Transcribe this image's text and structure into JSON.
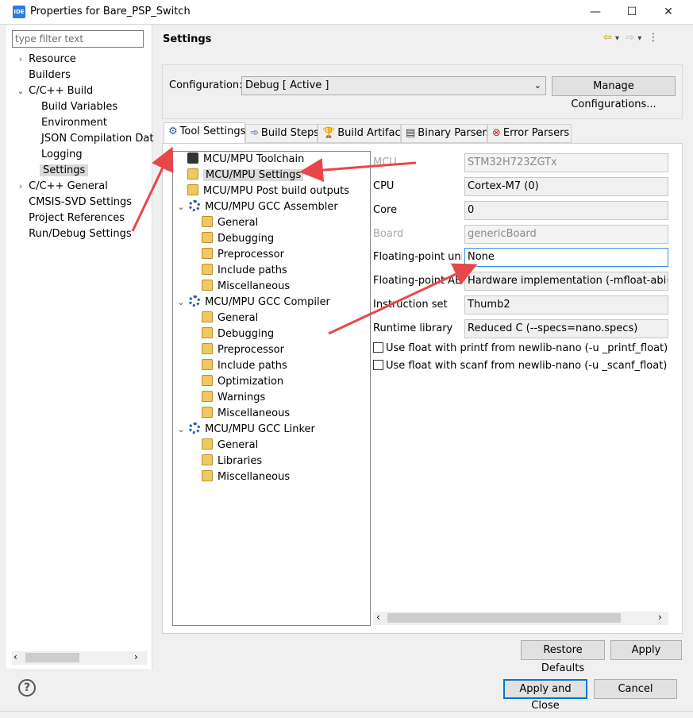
{
  "window": {
    "app_icon_text": "IDE",
    "title": "Properties for Bare_PSP_Switch",
    "minimize_glyph": "—",
    "maximize_glyph": "☐",
    "close_glyph": "✕"
  },
  "left": {
    "filter_placeholder": "type filter text",
    "tree": [
      {
        "label": "Resource",
        "chevron": "›"
      },
      {
        "label": "Builders",
        "chevron": ""
      },
      {
        "label": "C/C++ Build",
        "chevron": "⌄"
      },
      {
        "label": "Build Variables",
        "chevron": ""
      },
      {
        "label": "Environment",
        "chevron": ""
      },
      {
        "label": "JSON Compilation Dat",
        "chevron": ""
      },
      {
        "label": "Logging",
        "chevron": ""
      },
      {
        "label": "Settings",
        "chevron": "",
        "selected": true
      },
      {
        "label": "C/C++ General",
        "chevron": "›"
      },
      {
        "label": "CMSIS-SVD Settings",
        "chevron": ""
      },
      {
        "label": "Project References",
        "chevron": ""
      },
      {
        "label": "Run/Debug Settings",
        "chevron": ""
      }
    ],
    "scroll_left": "‹",
    "scroll_right": "›"
  },
  "header": {
    "title": "Settings",
    "back_icon": "⇦",
    "forward_icon": "⇨",
    "dropdown_icon": "▾",
    "menu_icon": "⋮"
  },
  "config": {
    "label": "Configuration:",
    "value": "Debug  [ Active ]",
    "manage_label": "Manage Configurations..."
  },
  "tabs": [
    {
      "label": "Tool Settings",
      "active": true
    },
    {
      "label": "Build Steps"
    },
    {
      "label": "Build Artifact"
    },
    {
      "label": "Binary Parsers"
    },
    {
      "label": "Error Parsers"
    }
  ],
  "tool_tree": [
    {
      "label": "MCU/MPU Toolchain"
    },
    {
      "label": "MCU/MPU Settings"
    },
    {
      "label": "MCU/MPU Post build outputs"
    },
    {
      "label": "MCU/MPU GCC Assembler"
    },
    {
      "label": "General"
    },
    {
      "label": "Debugging"
    },
    {
      "label": "Preprocessor"
    },
    {
      "label": "Include paths"
    },
    {
      "label": "Miscellaneous"
    },
    {
      "label": "MCU/MPU GCC Compiler"
    },
    {
      "label": "General"
    },
    {
      "label": "Debugging"
    },
    {
      "label": "Preprocessor"
    },
    {
      "label": "Include paths"
    },
    {
      "label": "Optimization"
    },
    {
      "label": "Warnings"
    },
    {
      "label": "Miscellaneous"
    },
    {
      "label": "MCU/MPU GCC Linker"
    },
    {
      "label": "General"
    },
    {
      "label": "Libraries"
    },
    {
      "label": "Miscellaneous"
    }
  ],
  "properties": [
    {
      "label": "MCU",
      "value": "STM32H723ZGTx",
      "disabled": true
    },
    {
      "label": "CPU",
      "value": "Cortex-M7 (0)"
    },
    {
      "label": "Core",
      "value": "0"
    },
    {
      "label": "Board",
      "value": "genericBoard",
      "disabled": true
    },
    {
      "label": "Floating-point unit",
      "value": "None",
      "focused": true
    },
    {
      "label": "Floating-point ABI",
      "value": "Hardware implementation (-mfloat-abi=hard)"
    },
    {
      "label": "Instruction set",
      "value": "Thumb2"
    },
    {
      "label": "Runtime library",
      "value": "Reduced C (--specs=nano.specs)"
    }
  ],
  "checkboxes": [
    {
      "label": "Use float with printf from newlib-nano (-u _printf_float)",
      "checked": false
    },
    {
      "label": "Use float with scanf from newlib-nano (-u _scanf_float)",
      "checked": false
    }
  ],
  "buttons": {
    "restore_defaults": "Restore Defaults",
    "apply": "Apply",
    "apply_and_close": "Apply and Close",
    "cancel": "Cancel",
    "help": "?"
  },
  "colors": {
    "annotation_arrow": "#e8474a",
    "focus_border": "#0078d7"
  }
}
